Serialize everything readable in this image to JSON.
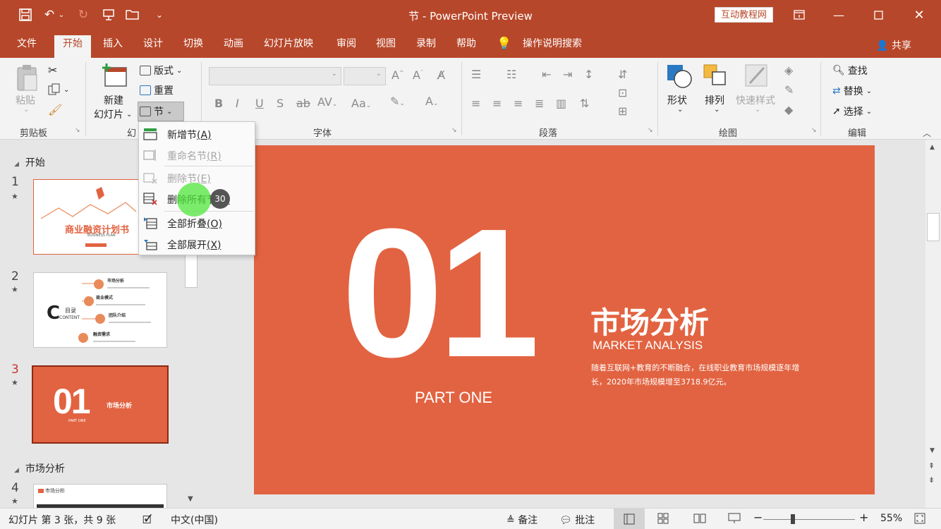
{
  "window": {
    "title": "节 - PowerPoint Preview",
    "brand_badge": "互动教程网"
  },
  "tabs": [
    "文件",
    "开始",
    "插入",
    "设计",
    "切换",
    "动画",
    "幻灯片放映",
    "审阅",
    "视图",
    "录制",
    "帮助",
    "操作说明搜索"
  ],
  "active_tab": "开始",
  "share_label": "共享",
  "ribbon": {
    "clipboard": {
      "paste": "粘贴",
      "group": "剪贴板"
    },
    "slides": {
      "new_slide_line1": "新建",
      "new_slide_line2": "幻灯片",
      "layout": "版式",
      "reset": "重置",
      "section": "节",
      "group": "幻"
    },
    "font": {
      "group": "字体"
    },
    "paragraph": {
      "group": "段落"
    },
    "drawing": {
      "shapes": "形状",
      "arrange": "排列",
      "quick_styles": "快速样式",
      "group": "绘图"
    },
    "editing": {
      "find": "查找",
      "replace": "替换",
      "select": "选择",
      "group": "编辑"
    }
  },
  "section_menu": {
    "items": [
      {
        "label": "新增节",
        "key": "(A)",
        "enabled": true
      },
      {
        "label": "重命名节",
        "key": "(R)",
        "enabled": false
      },
      {
        "label": "删除节",
        "key": "(E)",
        "enabled": false
      },
      {
        "label": "删除所有节",
        "key": "(L)",
        "enabled": true
      },
      {
        "label": "全部折叠",
        "key": "(O)",
        "enabled": true
      },
      {
        "label": "全部展开",
        "key": "(X)",
        "enabled": true
      }
    ]
  },
  "cursor_badge": "30",
  "slide_panel": {
    "sections": [
      "开始",
      "市场分析"
    ],
    "slides": [
      {
        "num": "1",
        "title": "商业融资计划书",
        "subtitle": "BUSINESS PLAN"
      },
      {
        "num": "2",
        "title": "目录",
        "subtitle": "CONTENT",
        "items": [
          "市场分析",
          "商业模式",
          "团队介绍",
          "融资需求"
        ]
      },
      {
        "num": "3",
        "title": "01",
        "subtitle": "市场分析",
        "extra": "PART ONE"
      },
      {
        "num": "4",
        "title": "市场分析"
      }
    ],
    "selected": "3"
  },
  "current_slide": {
    "number_text": "01",
    "part_label": "PART ONE",
    "heading": "市场分析",
    "subheading": "MARKET ANALYSIS",
    "body": "随着互联网+教育的不断融合，在线职业教育市场规模逐年增长，2020年市场规模增至3718.9亿元。",
    "background_color": "#e26341"
  },
  "status_bar": {
    "slide_info": "幻灯片 第 3 张，共 9 张",
    "language": "中文(中国)",
    "notes": "备注",
    "comments": "批注",
    "zoom": "55%"
  },
  "colors": {
    "accent": "#b7472a",
    "slide_bg": "#e26341"
  }
}
